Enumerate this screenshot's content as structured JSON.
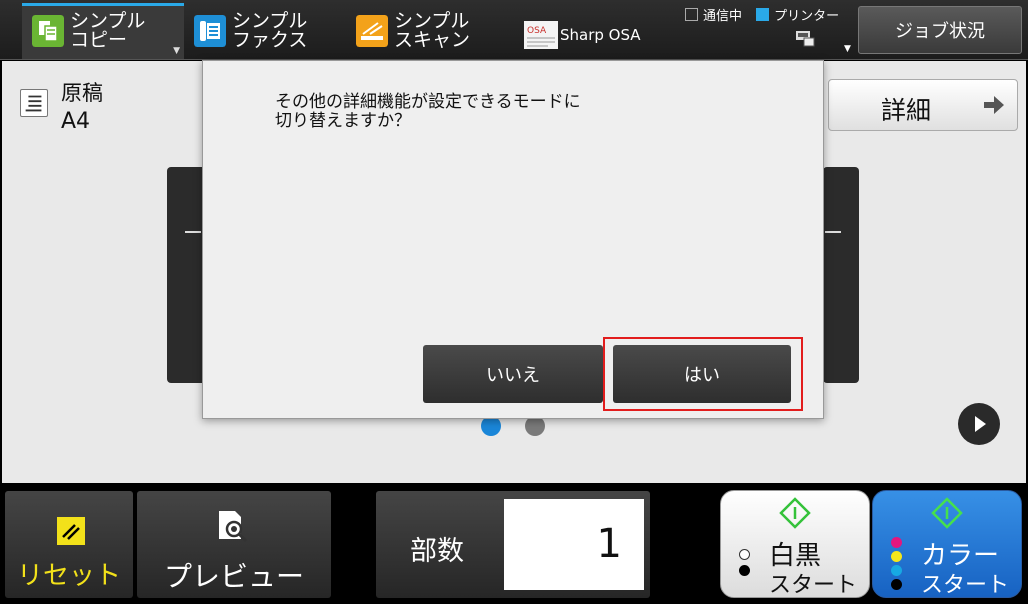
{
  "header": {
    "tabs": [
      {
        "label": "シンプル\nコピー",
        "icon": "copy-icon",
        "active": true
      },
      {
        "label": "シンプル\nファクス",
        "icon": "fax-icon",
        "active": false
      },
      {
        "label": "シンプル\nスキャン",
        "icon": "scan-icon",
        "active": false
      },
      {
        "label": "Sharp OSA",
        "icon": "osa-icon",
        "active": false
      }
    ],
    "status": {
      "communicating": "通信中",
      "printer": "プリンター"
    },
    "job_status_button": "ジョブ状況"
  },
  "main": {
    "original": {
      "title": "原稿",
      "value": "A4"
    },
    "detail_button": "詳細",
    "page_indicator": {
      "current": 1,
      "total": 2
    }
  },
  "dialog": {
    "message": "その他の詳細機能が設定できるモードに\n切り替えますか？",
    "no_button": "いいえ",
    "yes_button": "はい"
  },
  "footer": {
    "reset_button": "リセット",
    "preview_button": "プレビュー",
    "copies_label": "部数",
    "copies_value": "1",
    "bw_start": {
      "main": "白黒",
      "sub": "スタート"
    },
    "color_start": {
      "main": "カラー",
      "sub": "スタート"
    }
  },
  "colors": {
    "accent_blue": "#2aa9e8",
    "highlight_red": "#e21d1d",
    "reset_yellow": "#f2e11a",
    "color_start_blue": "#1f72d4"
  }
}
